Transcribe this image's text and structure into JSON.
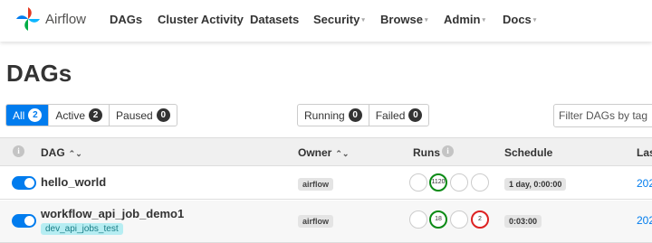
{
  "brand": {
    "name": "Airflow"
  },
  "nav": {
    "items": [
      {
        "label": "DAGs"
      },
      {
        "label": "Cluster Activity"
      },
      {
        "label": "Datasets"
      },
      {
        "label": "Security"
      },
      {
        "label": "Browse"
      },
      {
        "label": "Admin"
      },
      {
        "label": "Docs"
      }
    ]
  },
  "page": {
    "title": "DAGs"
  },
  "filters": {
    "all": {
      "label": "All",
      "count": "2"
    },
    "active": {
      "label": "Active",
      "count": "2"
    },
    "paused": {
      "label": "Paused",
      "count": "0"
    },
    "running": {
      "label": "Running",
      "count": "0"
    },
    "failed": {
      "label": "Failed",
      "count": "0"
    },
    "search_placeholder": "Filter DAGs by tag"
  },
  "table": {
    "headers": {
      "info": "i",
      "dag": "DAG",
      "owner": "Owner",
      "runs": "Runs",
      "schedule": "Schedule",
      "last": "Las"
    },
    "rows": [
      {
        "name": "hello_world",
        "tag": "",
        "owner": "airflow",
        "runs": [
          "",
          "1120",
          "",
          ""
        ],
        "schedule": "1 day, 0:00:00",
        "last_run": "202"
      },
      {
        "name": "workflow_api_job_demo1",
        "tag": "dev_api_jobs_test",
        "owner": "airflow",
        "runs": [
          "",
          "18",
          "",
          "2"
        ],
        "schedule": "0:03:00",
        "last_run": "202"
      }
    ]
  },
  "colors": {
    "accent": "#017cee",
    "success": "#0b8a15",
    "failed": "#dd2222",
    "tag_bg": "#b6edf2"
  }
}
